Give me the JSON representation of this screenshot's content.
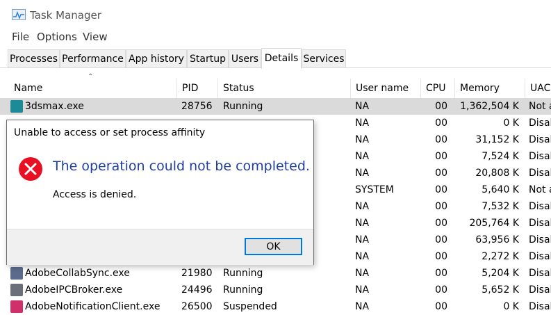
{
  "window": {
    "title": "Task Manager"
  },
  "menu": [
    "File",
    "Options",
    "View"
  ],
  "tabs": [
    {
      "label": "Processes",
      "active": false
    },
    {
      "label": "Performance",
      "active": false
    },
    {
      "label": "App history",
      "active": false
    },
    {
      "label": "Startup",
      "active": false
    },
    {
      "label": "Users",
      "active": false
    },
    {
      "label": "Details",
      "active": true
    },
    {
      "label": "Services",
      "active": false
    }
  ],
  "columns": [
    "Name",
    "PID",
    "Status",
    "User name",
    "CPU",
    "Memory (ac...",
    "UAC"
  ],
  "rows": [
    {
      "name": "3dsmax.exe",
      "pid": "28756",
      "status": "Running",
      "user": "NA",
      "cpu": "00",
      "memory": "1,362,504 K",
      "uac": "Not a",
      "icon": "3dsmax-icon",
      "color": "#1d8a98",
      "selected": true
    },
    {
      "name": "",
      "pid": "",
      "status": "",
      "user": "NA",
      "cpu": "00",
      "memory": "0 K",
      "uac": "Disal",
      "icon": "",
      "color": "",
      "selected": false
    },
    {
      "name": "",
      "pid": "",
      "status": "",
      "user": "NA",
      "cpu": "00",
      "memory": "31,152 K",
      "uac": "Disal",
      "icon": "",
      "color": "",
      "selected": false
    },
    {
      "name": "",
      "pid": "",
      "status": "",
      "user": "NA",
      "cpu": "00",
      "memory": "7,524 K",
      "uac": "Disal",
      "icon": "",
      "color": "",
      "selected": false
    },
    {
      "name": "",
      "pid": "",
      "status": "",
      "user": "NA",
      "cpu": "00",
      "memory": "20,808 K",
      "uac": "Disal",
      "icon": "",
      "color": "",
      "selected": false
    },
    {
      "name": "",
      "pid": "",
      "status": "",
      "user": "SYSTEM",
      "cpu": "00",
      "memory": "5,640 K",
      "uac": "Not a",
      "icon": "",
      "color": "",
      "selected": false
    },
    {
      "name": "",
      "pid": "",
      "status": "",
      "user": "NA",
      "cpu": "00",
      "memory": "7,532 K",
      "uac": "Disal",
      "icon": "",
      "color": "",
      "selected": false
    },
    {
      "name": "",
      "pid": "",
      "status": "",
      "user": "NA",
      "cpu": "00",
      "memory": "205,764 K",
      "uac": "Disal",
      "icon": "",
      "color": "",
      "selected": false
    },
    {
      "name": "",
      "pid": "",
      "status": "",
      "user": "NA",
      "cpu": "00",
      "memory": "63,956 K",
      "uac": "Disal",
      "icon": "",
      "color": "",
      "selected": false
    },
    {
      "name": "",
      "pid": "",
      "status": "",
      "user": "NA",
      "cpu": "00",
      "memory": "2,272 K",
      "uac": "Disal",
      "icon": "",
      "color": "",
      "selected": false
    },
    {
      "name": "AdobeCollabSync.exe",
      "pid": "21980",
      "status": "Running",
      "user": "NA",
      "cpu": "00",
      "memory": "5,204 K",
      "uac": "Disal",
      "icon": "adobe-collab-icon",
      "color": "#5a6b8c",
      "selected": false
    },
    {
      "name": "AdobeIPCBroker.exe",
      "pid": "24496",
      "status": "Running",
      "user": "NA",
      "cpu": "00",
      "memory": "5,652 K",
      "uac": "Disal",
      "icon": "adobe-ipc-icon",
      "color": "#6a6f7a",
      "selected": false
    },
    {
      "name": "AdobeNotificationClient.exe",
      "pid": "26500",
      "status": "Suspended",
      "user": "NA",
      "cpu": "00",
      "memory": "0 K",
      "uac": "Disal",
      "icon": "adobe-notification-icon",
      "color": "#d0306a",
      "selected": false
    }
  ],
  "dialog": {
    "title": "Unable to access or set process affinity",
    "main_instruction": "The operation could not be completed.",
    "content": "Access is denied.",
    "ok_label": "OK",
    "error_icon": "error-icon",
    "error_color": "#e81123"
  }
}
